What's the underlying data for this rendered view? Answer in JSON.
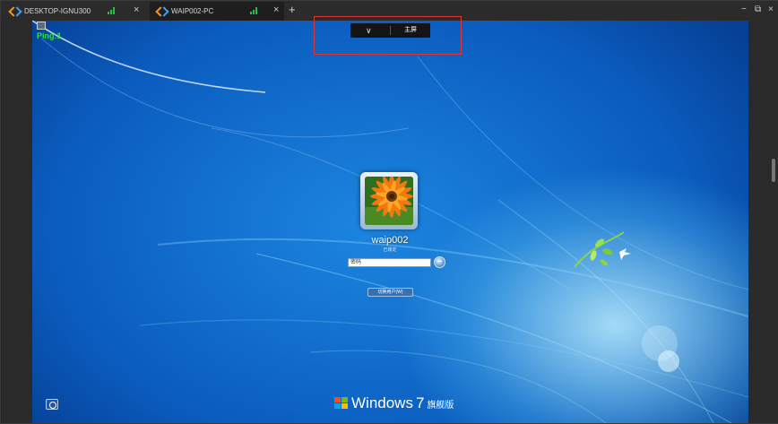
{
  "tabs": [
    {
      "label": "DESKTOP-IGNU300",
      "active": false
    },
    {
      "label": "WAIP002-PC",
      "active": true
    }
  ],
  "tabbar": {
    "add_symbol": "+",
    "close_symbol": "×"
  },
  "window_controls": {
    "minimize": "−",
    "restore": "⧉",
    "close": "×"
  },
  "floating_toolbar": {
    "collapse_symbol": "∨",
    "home_label": "主屏"
  },
  "ping": {
    "label": "Ping:1"
  },
  "login": {
    "username": "waip002",
    "status": "已锁定",
    "password_placeholder": "密码",
    "switch_user_label": "切换用户(W)"
  },
  "branding": {
    "product": "Windows",
    "version": "7",
    "edition": "旗舰版"
  },
  "colors": {
    "signal": "#27c03a",
    "ping": "#2de050",
    "highlight": "#e03535",
    "desktop_blue": "#0a5bbd"
  },
  "icons": {
    "tab_logo": "remote-desktop-icon",
    "signal": "signal-strength-icon",
    "go": "arrow-right-icon",
    "ease": "ease-of-access-icon"
  }
}
